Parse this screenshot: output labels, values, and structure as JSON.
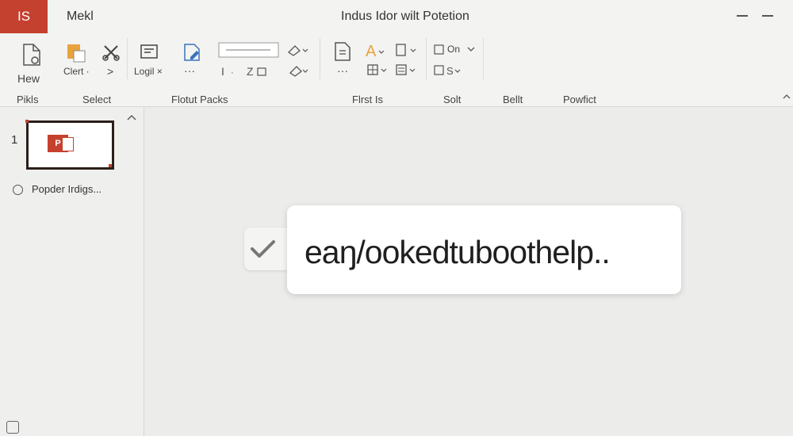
{
  "titlebar": {
    "app_tab": "IS",
    "menu_label": "Mekl",
    "window_title": "Indus Idor wilt Potetion"
  },
  "ribbon": {
    "new_label_line1": "Hew",
    "new_label_line2": "Pikls",
    "clear_label": "Clert ·",
    "arrow_label": ">",
    "login_label": "Logil ×",
    "group_labels": {
      "select": "Select",
      "format_packs": "Flotut Packs",
      "first_is": "Flrst Is",
      "sort": "Solt",
      "belt": "Bellt",
      "powfict": "Powfict"
    },
    "on_label": "On",
    "dots_label": "···"
  },
  "slides": {
    "slide_number": "1",
    "ppt_badge": "P",
    "radio_label": "Popder Irdigs..."
  },
  "toast": {
    "text": "eaŋ/ookedtuboothelp.."
  },
  "colors": {
    "accent": "#c4402f",
    "background": "#ececeb",
    "ribbon": "#f3f3f2",
    "icon_blue": "#3b73b9",
    "icon_orange": "#e8a33c"
  }
}
